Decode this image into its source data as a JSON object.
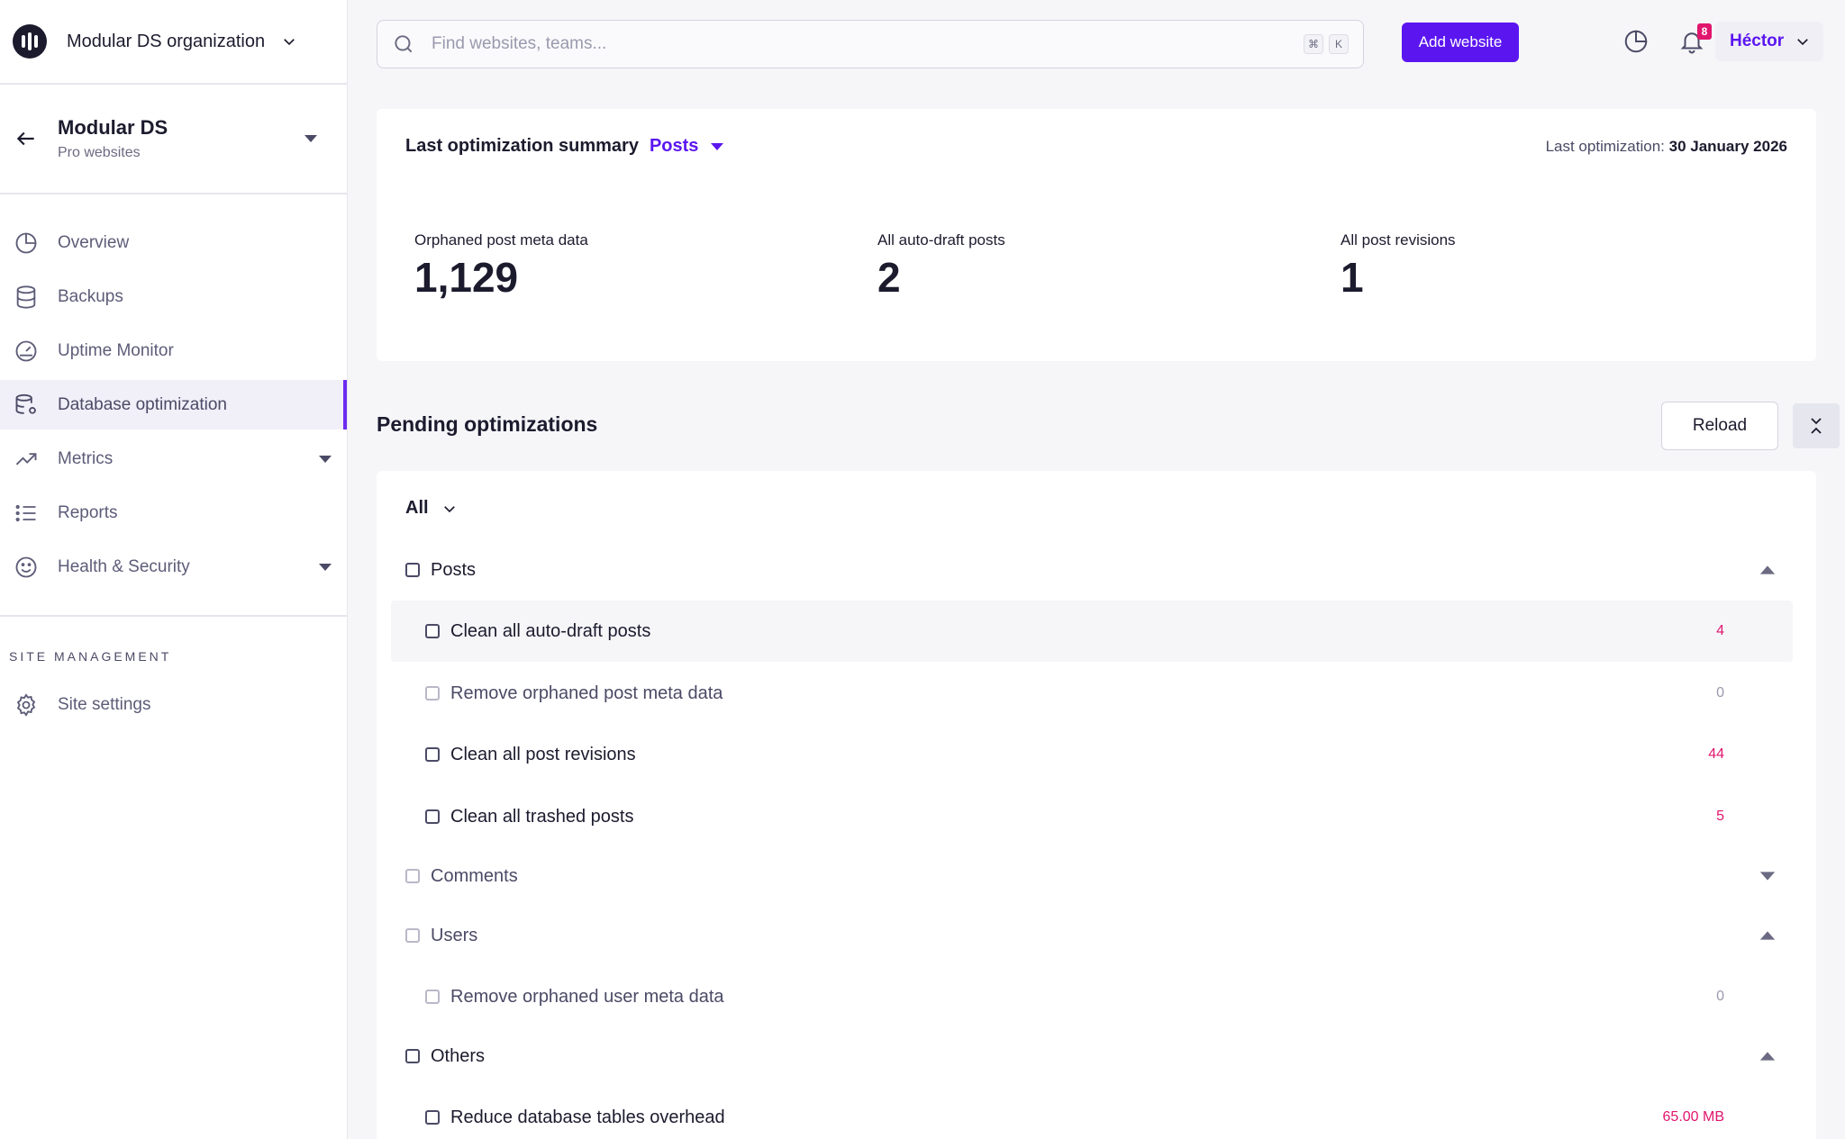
{
  "org": {
    "name": "Modular DS organization"
  },
  "site": {
    "name": "Modular DS",
    "subtitle": "Pro websites"
  },
  "nav": {
    "items": [
      {
        "label": "Overview"
      },
      {
        "label": "Backups"
      },
      {
        "label": "Uptime Monitor"
      },
      {
        "label": "Database optimization"
      },
      {
        "label": "Metrics"
      },
      {
        "label": "Reports"
      },
      {
        "label": "Health & Security"
      }
    ],
    "section_title": "SITE MANAGEMENT",
    "settings_label": "Site settings"
  },
  "topbar": {
    "search_placeholder": "Find websites, teams...",
    "shortcut_keys": [
      "⌘",
      "K"
    ],
    "add_website_label": "Add website",
    "notification_count": "8",
    "user_name": "Héctor"
  },
  "summary": {
    "title": "Last optimization summary",
    "filter_label": "Posts",
    "last_optimization_label": "Last optimization:",
    "last_optimization_date": "30 January 2026",
    "stats": [
      {
        "label": "Orphaned post meta data",
        "value": "1,129"
      },
      {
        "label": "All auto-draft posts",
        "value": "2"
      },
      {
        "label": "All post revisions",
        "value": "1"
      }
    ]
  },
  "pending": {
    "title": "Pending optimizations",
    "reload_label": "Reload",
    "filter_label": "All",
    "groups": {
      "posts": "Posts",
      "comments": "Comments",
      "users": "Users",
      "others": "Others"
    },
    "items": [
      {
        "label": "Clean all auto-draft posts",
        "count": "4"
      },
      {
        "label": "Remove orphaned post meta data",
        "count": "0"
      },
      {
        "label": "Clean all post revisions",
        "count": "44"
      },
      {
        "label": "Clean all trashed posts",
        "count": "5"
      },
      {
        "label": "Remove orphaned user meta data",
        "count": "0"
      },
      {
        "label": "Reduce database tables overhead",
        "count": "65.00 MB"
      }
    ]
  },
  "colors": {
    "accent": "#5b16f0",
    "badge": "#e0166e",
    "count_highlight": "#e0166e",
    "text_dark": "#1c1b2e"
  }
}
